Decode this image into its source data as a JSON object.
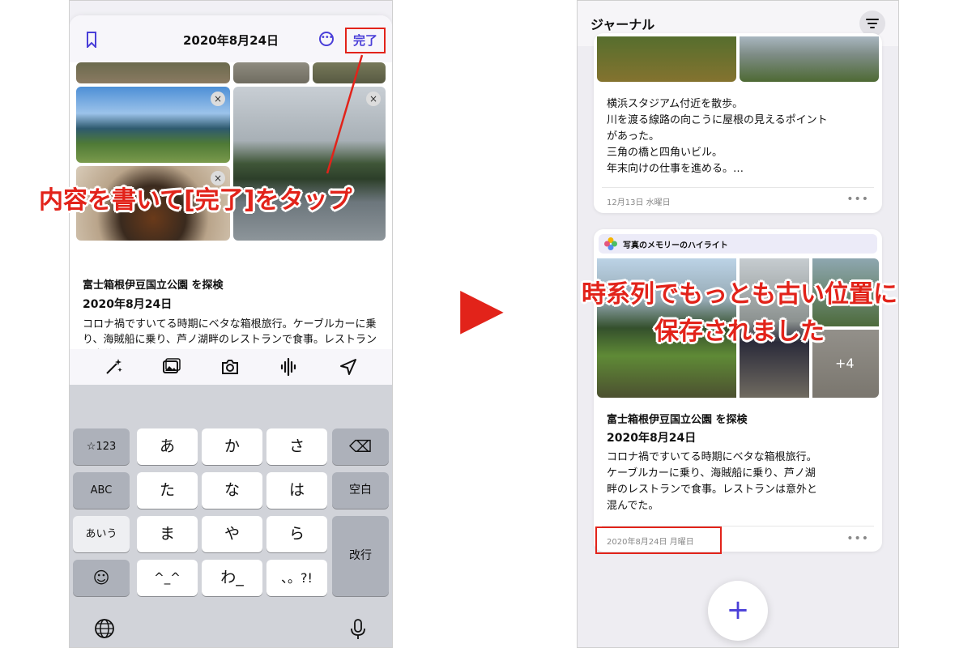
{
  "left": {
    "editor": {
      "date_title": "2020年8月24日",
      "more_glyph": "•••",
      "done_label": "完了",
      "remove_glyph": "×",
      "entry_title": "富士箱根伊豆国立公園 を探検",
      "entry_date": "2020年8月24日",
      "entry_body": "コロナ禍ですいてる時期にベタな箱根旅行。ケーブルカーに乗り、海賊船に乗り、芦ノ湖畔のレストランで食事。レストランは意外と混んでた。"
    },
    "toolbar_icons": [
      "magic-wand-icon",
      "photo-library-icon",
      "camera-icon",
      "waveform-icon",
      "location-arrow-icon"
    ],
    "keyboard": {
      "rows": [
        {
          "left": "☆123",
          "keys": [
            "あ",
            "か",
            "さ"
          ],
          "right": "⌫"
        },
        {
          "left": "ABC",
          "keys": [
            "た",
            "な",
            "は"
          ],
          "right": "空白"
        },
        {
          "left": "あいう",
          "keys": [
            "ま",
            "や",
            "ら"
          ],
          "right": "改行"
        },
        {
          "left": "☺",
          "keys": [
            "^_^",
            "わ_",
            "、。?!"
          ]
        }
      ],
      "globe_icon": "globe-icon",
      "mic_icon": "microphone-icon"
    }
  },
  "annotations": {
    "left_callout": "内容を書いて[完了]をタップ",
    "right_callout_line1": "時系列でもっとも古い位置に",
    "right_callout_line2": "保存されました",
    "arrow_glyph": "▶"
  },
  "right": {
    "header_title": "ジャーナル",
    "card1": {
      "lines": [
        "横浜スタジアム付近を散歩。",
        "川を渡る線路の向こうに屋根の見えるポイント",
        "があった。",
        "三角の橋と四角いビル。",
        "年末向けの仕事を進める。…"
      ],
      "footer_date": "12月13日 水曜日",
      "dots": "•••"
    },
    "card2": {
      "highlight_label": "写真のメモリーのハイライト",
      "more_photos": "+4",
      "title": "富士箱根伊豆国立公園 を探検",
      "date": "2020年8月24日",
      "lines": [
        "コロナ禍ですいてる時期にベタな箱根旅行。",
        "ケーブルカーに乗り、海賊船に乗り、芦ノ湖",
        "畔のレストランで食事。レストランは意外と",
        "混んでた。"
      ],
      "footer_date": "2020年8月24日 月曜日",
      "dots": "•••"
    },
    "fab_label": "+"
  },
  "colors": {
    "accent": "#4a3fd8",
    "annotation_red": "#e2231a",
    "keyboard_bg": "#d1d3d9"
  }
}
